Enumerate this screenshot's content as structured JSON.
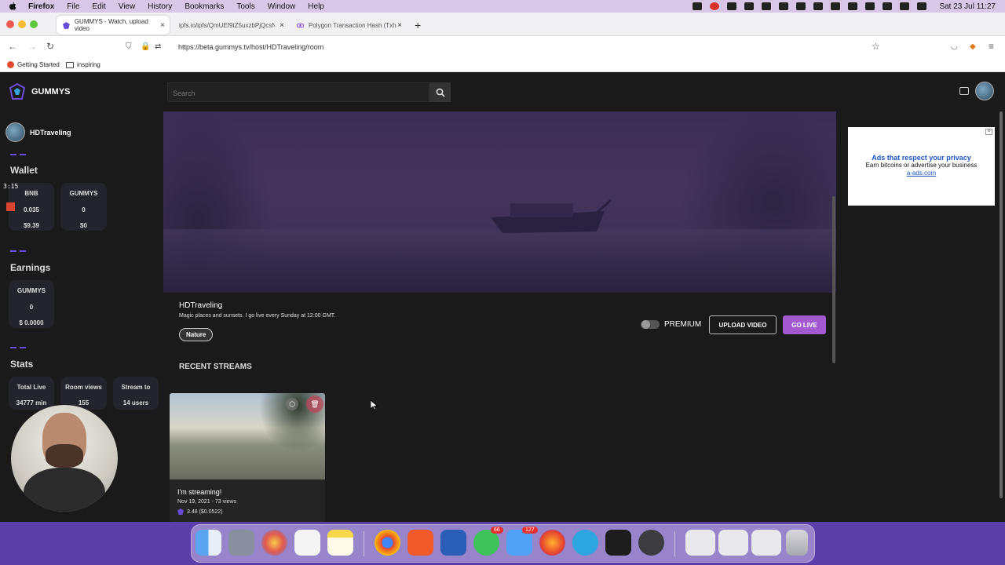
{
  "menubar": {
    "app": "Firefox",
    "items": [
      "File",
      "Edit",
      "View",
      "History",
      "Bookmarks",
      "Tools",
      "Window",
      "Help"
    ],
    "clock": "Sat 23 Jul  11:27"
  },
  "browser": {
    "tabs": [
      {
        "title": "GUMMYS - Watch, upload video"
      },
      {
        "title": "ipfs.io/ipfs/QmUEf9tZ5uxzbPjQcsN"
      },
      {
        "title": "Polygon Transaction Hash (Txha"
      }
    ],
    "url": "https://beta.gummys.tv/host/HDTraveling/room",
    "bookmarks": [
      "Getting Started",
      "inspiring"
    ]
  },
  "app": {
    "brand": "GUMMYS",
    "search_placeholder": "Search"
  },
  "sidebar": {
    "user": "HDTraveling",
    "wallet_title": "Wallet",
    "wallet": [
      {
        "token": "BNB",
        "amount": "0.035",
        "usd": "$9.39"
      },
      {
        "token": "GUMMYS",
        "amount": "0",
        "usd": "$0"
      }
    ],
    "earnings_title": "Earnings",
    "earnings": {
      "token": "GUMMYS",
      "amount": "0",
      "usd": "$ 0.0000"
    },
    "stats_title": "Stats",
    "stats": [
      {
        "label": "Total Live",
        "value": "34777 min"
      },
      {
        "label": "Room views",
        "value": "155"
      },
      {
        "label": "Stream to",
        "value": "14 users"
      }
    ]
  },
  "host": {
    "name": "HDTraveling",
    "description": "Magic places and sunsets. I go live every Sunday at 12:00 GMT.",
    "tag": "Nature",
    "premium_label": "PREMIUM",
    "upload_label": "UPLOAD VIDEO",
    "golive_label": "GO LIVE"
  },
  "recent": {
    "title": "RECENT STREAMS",
    "streams": [
      {
        "title": "I'm streaming!",
        "meta": "Nov 19, 2021 - 73 views",
        "price": "3.48 ($0.0522)"
      }
    ]
  },
  "ad": {
    "headline": "Ads that respect your privacy",
    "body": "Earn bitcoins or advertise your business",
    "link": "a-ads.com"
  },
  "overlay": {
    "timer": "3:15"
  },
  "dock": {
    "whatsapp_badge": "66",
    "mail_badge": "127"
  },
  "colors": {
    "accent": "#a35ad0",
    "brand_purple": "#6a4cd8",
    "background": "#1a1a1a"
  }
}
